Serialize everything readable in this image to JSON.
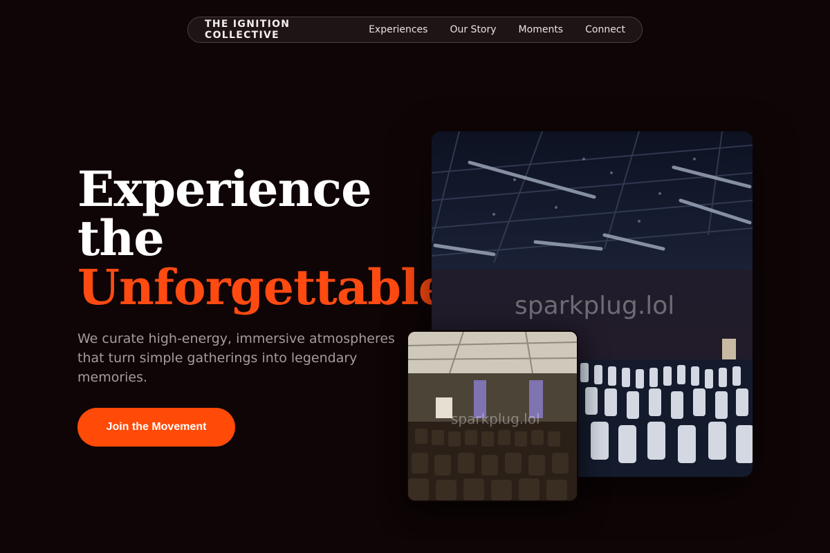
{
  "nav": {
    "brand": "THE IGNITION COLLECTIVE",
    "links": [
      "Experiences",
      "Our Story",
      "Moments",
      "Connect"
    ]
  },
  "hero": {
    "headline_line1": "Experience",
    "headline_line2": "the",
    "headline_accent": "Unforgettable.",
    "subtitle": "We curate high-energy, immersive atmospheres that turn simple gatherings into legendary memories.",
    "cta_label": "Join the Movement"
  },
  "images": {
    "main_watermark": "sparkplug.lol",
    "small_watermark": "sparkplug.lol"
  },
  "colors": {
    "background": "#0f0506",
    "accent": "#ff4a12",
    "text": "#ffffff",
    "muted": "#a59c9d"
  }
}
